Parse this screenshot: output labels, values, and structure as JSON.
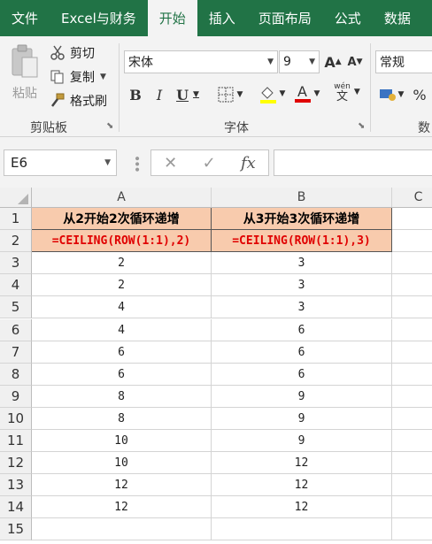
{
  "tabs": [
    {
      "label": "文件",
      "active": false
    },
    {
      "label": "Excel与财务",
      "active": false
    },
    {
      "label": "开始",
      "active": true
    },
    {
      "label": "插入",
      "active": false
    },
    {
      "label": "页面布局",
      "active": false
    },
    {
      "label": "公式",
      "active": false
    },
    {
      "label": "数据",
      "active": false
    }
  ],
  "clipboard": {
    "paste": "粘贴",
    "cut": "剪切",
    "copy": "复制",
    "format_painter": "格式刷",
    "group_label": "剪贴板"
  },
  "font": {
    "name": "宋体",
    "size": "9",
    "bold": "B",
    "italic": "I",
    "underline": "U",
    "font_color_glyph": "A",
    "phonetic_top": "wén",
    "phonetic_bottom": "文",
    "grow": "A",
    "shrink": "A",
    "group_label": "字体"
  },
  "number": {
    "format": "常规",
    "percent": "%",
    "group_label": "数"
  },
  "formula_bar": {
    "name_box": "E6",
    "fx": "fx",
    "cancel": "✕",
    "enter": "✓",
    "content": ""
  },
  "sheet": {
    "columns": [
      "A",
      "B",
      "C"
    ],
    "rows": [
      {
        "n": "1",
        "a": "从2开始2次循环递增",
        "b": "从3开始3次循环递增"
      },
      {
        "n": "2",
        "a": "=CEILING(ROW(1:1),2)",
        "b": "=CEILING(ROW(1:1),3)"
      },
      {
        "n": "3",
        "a": "2",
        "b": "3"
      },
      {
        "n": "4",
        "a": "2",
        "b": "3"
      },
      {
        "n": "5",
        "a": "4",
        "b": "3"
      },
      {
        "n": "6",
        "a": "4",
        "b": "6"
      },
      {
        "n": "7",
        "a": "6",
        "b": "6"
      },
      {
        "n": "8",
        "a": "6",
        "b": "6"
      },
      {
        "n": "9",
        "a": "8",
        "b": "9"
      },
      {
        "n": "10",
        "a": "8",
        "b": "9"
      },
      {
        "n": "11",
        "a": "10",
        "b": "9"
      },
      {
        "n": "12",
        "a": "10",
        "b": "12"
      },
      {
        "n": "13",
        "a": "12",
        "b": "12"
      },
      {
        "n": "14",
        "a": "12",
        "b": "12"
      },
      {
        "n": "15",
        "a": "",
        "b": ""
      }
    ]
  },
  "colors": {
    "brand": "#217346",
    "header_fill": "#f8cbad",
    "formula_text": "#e00000"
  }
}
